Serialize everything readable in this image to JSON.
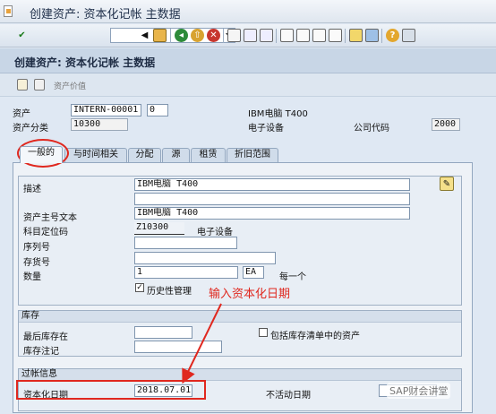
{
  "window": {
    "title": "创建资产: 资本化记帐 主数据"
  },
  "toolbar": {
    "command_value": ""
  },
  "screen": {
    "title": "创建资产: 资本化记帐 主数据"
  },
  "app_toolbar": {
    "asset_values_label": "资产价值"
  },
  "header": {
    "asset_label": "资产",
    "asset_number": "INTERN-00001",
    "asset_sub": "0",
    "asset_desc": "IBM电脑  T400",
    "class_label": "资产分类",
    "class_value": "10300",
    "class_desc": "电子设备",
    "company_label": "公司代码",
    "company_value": "2000"
  },
  "tabs": [
    "一般的",
    "与时间相关",
    "分配",
    "源",
    "租赁",
    "折旧范围"
  ],
  "general": {
    "desc_label": "描述",
    "desc_value": "IBM电脑  T400",
    "desc2_value": "",
    "main_text_label": "资产主号文本",
    "main_text_value": "IBM电脑  T400",
    "account_label": "科目定位码",
    "account_value": "Z10300",
    "account_desc": "电子设备",
    "serial_label": "序列号",
    "serial_value": "",
    "inventory_no_label": "存货号",
    "inventory_no_value": "",
    "qty_label": "数量",
    "qty_value": "1",
    "unit_value": "EA",
    "each_label": "每一个",
    "history_label": "历史性管理",
    "history_checked": true
  },
  "inventory": {
    "title": "库存",
    "last_label": "最后库存在",
    "last_value": "",
    "note_label": "库存注记",
    "note_value": "",
    "include_label": "包括库存清单中的资产",
    "include_checked": false
  },
  "posting": {
    "title": "过帐信息",
    "cap_date_label": "资本化日期",
    "cap_date_value": "2018.07.01",
    "inactive_label": "不活动日期",
    "inactive_value": ""
  },
  "annotation": {
    "text": "输入资本化日期"
  },
  "watermark": {
    "text": "SAP财会讲堂"
  },
  "colors": {
    "annotation": "#e0281f",
    "frame_bg": "#dfe8f3"
  }
}
